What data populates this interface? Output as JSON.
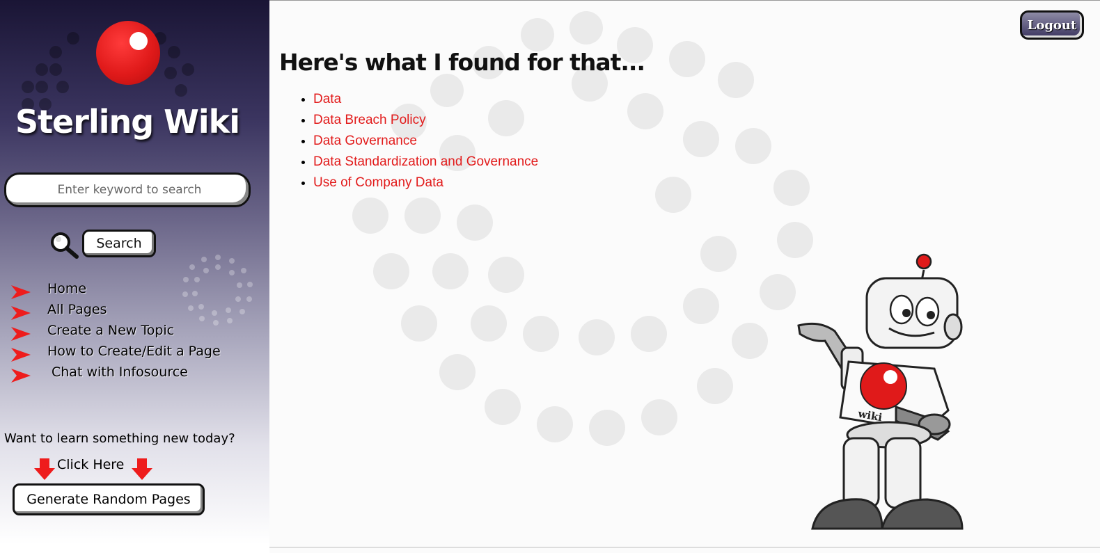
{
  "sidebar": {
    "site_title": "Sterling Wiki",
    "search_placeholder": "Enter keyword to search",
    "search_button": "Search",
    "nav_items": [
      {
        "label": "Home"
      },
      {
        "label": "All Pages"
      },
      {
        "label": "Create a New Topic"
      },
      {
        "label": "How to Create/Edit a Page"
      },
      {
        "label": "Chat with Infosource"
      }
    ],
    "learn_prompt": "Want to learn something new today?",
    "click_here": "Click Here",
    "random_button": "Generate Random Pages"
  },
  "header": {
    "logout_button": "Logout"
  },
  "main": {
    "heading": "Here's what I found for that...",
    "results": [
      {
        "label": "Data"
      },
      {
        "label": "Data Breach Policy"
      },
      {
        "label": "Data Governance"
      },
      {
        "label": "Data Standardization and Governance"
      },
      {
        "label": "Use of Company Data"
      }
    ]
  },
  "colors": {
    "accent_red": "#e21b1b",
    "sidebar_dark": "#1a1535",
    "link_red": "#e21b1b"
  },
  "icons": {
    "logo": "red-ball-logo-icon",
    "search": "magnifier-icon",
    "nav_bullet": "red-arrow-icon",
    "down_arrow": "red-down-arrow-icon",
    "mascot": "robot-mascot"
  }
}
